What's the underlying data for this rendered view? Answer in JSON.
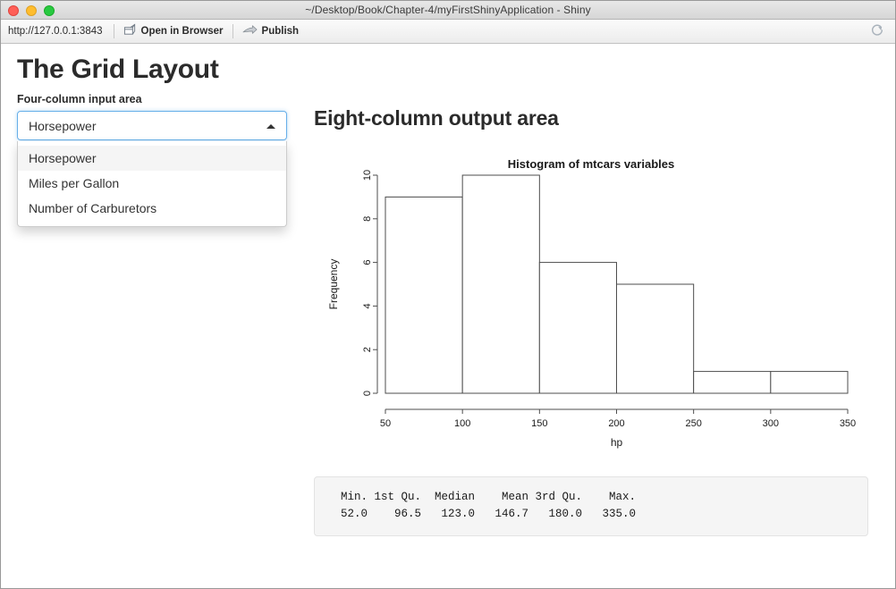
{
  "window": {
    "title": "~/Desktop/Book/Chapter-4/myFirstShinyApplication - Shiny",
    "controls": {
      "close": "close",
      "minimize": "minimize",
      "zoom": "zoom"
    }
  },
  "toolbar": {
    "url": "http://127.0.0.1:3843",
    "open_in_browser": "Open in Browser",
    "publish": "Publish",
    "refresh": "refresh"
  },
  "page": {
    "heading": "The Grid Layout",
    "input_area_label": "Four-column input area",
    "output_area_heading": "Eight-column output area"
  },
  "select": {
    "value": "Horsepower",
    "expanded": true,
    "options": [
      {
        "label": "Horsepower",
        "selected": true
      },
      {
        "label": "Miles per Gallon",
        "selected": false
      },
      {
        "label": "Number of Carburetors",
        "selected": false
      }
    ]
  },
  "summary": {
    "header_row": "  Min. 1st Qu.  Median    Mean 3rd Qu.    Max. ",
    "value_row": "  52.0    96.5   123.0   146.7   180.0   335.0 ",
    "headers": [
      "Min.",
      "1st Qu.",
      "Median",
      "Mean",
      "3rd Qu.",
      "Max."
    ],
    "values": [
      "52.0",
      "96.5",
      "123.0",
      "146.7",
      "180.0",
      "335.0"
    ]
  },
  "chart_data": {
    "type": "bar",
    "title": "Histogram of mtcars variables",
    "xlabel": "hp",
    "ylabel": "Frequency",
    "xlim": [
      50,
      350
    ],
    "ylim": [
      0,
      10
    ],
    "xticks": [
      50,
      100,
      150,
      200,
      250,
      300,
      350
    ],
    "yticks": [
      0,
      2,
      4,
      6,
      8,
      10
    ],
    "grid": false,
    "legend": null,
    "bin_width": 50,
    "bins": [
      {
        "x0": 50,
        "x1": 100,
        "value": 9
      },
      {
        "x0": 100,
        "x1": 150,
        "value": 10
      },
      {
        "x0": 150,
        "x1": 200,
        "value": 6
      },
      {
        "x0": 200,
        "x1": 250,
        "value": 5
      },
      {
        "x0": 250,
        "x1": 300,
        "value": 1
      },
      {
        "x0": 300,
        "x1": 350,
        "value": 1
      }
    ],
    "categories": [
      "50-100",
      "100-150",
      "150-200",
      "200-250",
      "250-300",
      "300-350"
    ],
    "values": [
      9,
      10,
      6,
      5,
      1,
      1
    ]
  }
}
